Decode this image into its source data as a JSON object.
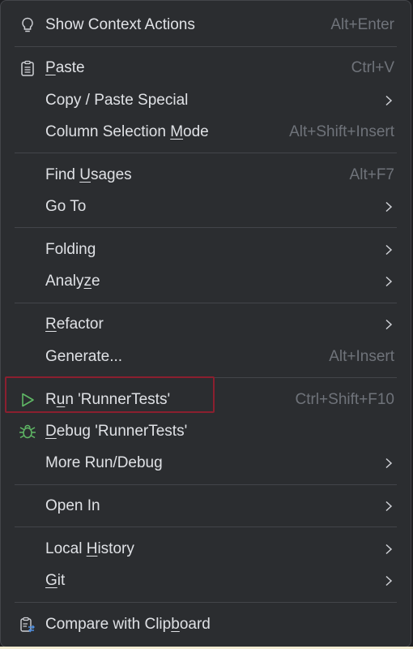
{
  "menu": {
    "items": [
      {
        "label": "Show Context Actions",
        "shortcut": "Alt+Enter"
      },
      {
        "label_pre": "",
        "label_u": "P",
        "label_post": "aste",
        "shortcut": "Ctrl+V"
      },
      {
        "label": "Copy / Paste Special"
      },
      {
        "label_pre": "Column Selection ",
        "label_u": "M",
        "label_post": "ode",
        "shortcut": "Alt+Shift+Insert"
      },
      {
        "label_pre": "Find ",
        "label_u": "U",
        "label_post": "sages",
        "shortcut": "Alt+F7"
      },
      {
        "label": "Go To"
      },
      {
        "label": "Folding"
      },
      {
        "label_pre": "Analy",
        "label_u": "z",
        "label_post": "e"
      },
      {
        "label_pre": "",
        "label_u": "R",
        "label_post": "efactor"
      },
      {
        "label": "Generate...",
        "shortcut": "Alt+Insert"
      },
      {
        "label_pre": "R",
        "label_u": "u",
        "label_post": "n 'RunnerTests'",
        "shortcut": "Ctrl+Shift+F10"
      },
      {
        "label_pre": "",
        "label_u": "D",
        "label_post": "ebug 'RunnerTests'"
      },
      {
        "label": "More Run/Debug"
      },
      {
        "label": "Open In"
      },
      {
        "label_pre": "Local ",
        "label_u": "H",
        "label_post": "istory"
      },
      {
        "label_pre": "",
        "label_u": "G",
        "label_post": "it"
      },
      {
        "label_pre": "Compare with Clip",
        "label_u": "b",
        "label_post": "oard"
      }
    ]
  },
  "icons": {
    "show_context_actions": "lightbulb-icon",
    "paste": "clipboard-icon",
    "run": "play-icon",
    "debug": "bug-icon",
    "compare_clipboard": "compare-clipboard-icon"
  },
  "colors": {
    "background": "#2b2d30",
    "text": "#dfe1e5",
    "shortcut": "#6f737a",
    "run_green": "#5fb865",
    "highlight_border": "#8b1f2f"
  }
}
